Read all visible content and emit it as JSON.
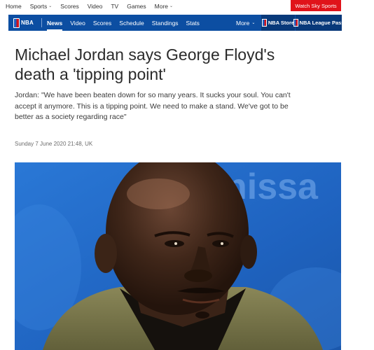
{
  "topnav": {
    "items": [
      {
        "label": "Home",
        "has_menu": false
      },
      {
        "label": "Sports",
        "has_menu": true
      },
      {
        "label": "Scores",
        "has_menu": false
      },
      {
        "label": "Video",
        "has_menu": false
      },
      {
        "label": "TV",
        "has_menu": false
      },
      {
        "label": "Games",
        "has_menu": false
      },
      {
        "label": "More",
        "has_menu": true
      }
    ],
    "watch_button": "Watch Sky Sports",
    "accent_color": "#e0131a"
  },
  "nba_nav": {
    "logo_text": "NBA",
    "links": [
      "News",
      "Video",
      "Scores",
      "Schedule",
      "Standings",
      "Stats"
    ],
    "active_link": "News",
    "more_label": "More",
    "store_label": "NBA Store",
    "league_pass_label": "NBA League Pass",
    "bar_color": "#0c4ea2"
  },
  "article": {
    "headline": "Michael Jordan says George Floyd's death a 'tipping point'",
    "standfirst": "Jordan: \"We have been beaten down for so many years. It sucks your soul. You can't accept it anymore. This is a tipping point. We need to make a stand. We've got to be better as a society regarding race\"",
    "timestamp": "Sunday 7 June 2020 21:48, UK"
  },
  "photo": {
    "background_text": "nissa"
  }
}
